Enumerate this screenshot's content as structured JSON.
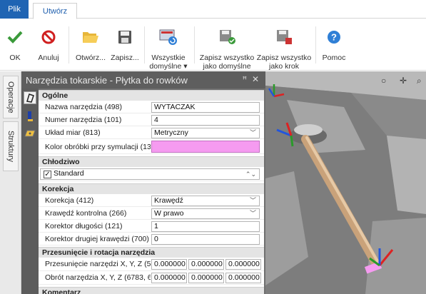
{
  "tabs": {
    "file": "Plik",
    "create": "Utwórz"
  },
  "ribbon": {
    "ok": "OK",
    "cancel": "Anuluj",
    "open": "Otwórz...",
    "save": "Zapisz...",
    "all_defaults_1": "Wszystkie",
    "all_defaults_2": "domyślne ▾",
    "save_all_default_1": "Zapisz wszystko",
    "save_all_default_2": "jako domyślne",
    "save_all_step_1": "Zapisz wszystko",
    "save_all_step_2": "jako krok",
    "help": "Pomoc"
  },
  "side_tabs": {
    "operations": "Operacje",
    "structures": "Struktury"
  },
  "panel": {
    "title": "Narzędzia tokarskie - Płytka do rowków",
    "pin": "ꟸ",
    "close": "✕"
  },
  "sections": {
    "general": "Ogólne",
    "coolant": "Chłodziwo",
    "correction": "Korekcja",
    "shift": "Przesunięcie i rotacja narzędzia",
    "comment": "Komentarz"
  },
  "general": {
    "tool_name_label": "Nazwa narzędzia (498)",
    "tool_name_value": "WYTACZAK",
    "tool_number_label": "Numer narzędzia (101)",
    "tool_number_value": "4",
    "units_label": "Układ miar (813)",
    "units_value": "Metryczny",
    "color_label": "Kolor obróbki przy symulacji (13..."
  },
  "coolant": {
    "standard": "Standard"
  },
  "correction": {
    "corr_label": "Korekcja (412)",
    "corr_value": "Krawędź",
    "edge_label": "Krawędź kontrolna (266)",
    "edge_value": "W prawo",
    "len_label": "Korektor długości (121)",
    "len_value": "1",
    "edge2_label": "Korektor drugiej krawędzi (700)",
    "edge2_value": "0"
  },
  "shift": {
    "move_label": "Przesunięcie narzędzi X, Y, Z (5...",
    "move_x": "0.000000",
    "move_y": "0.000000",
    "move_z": "0.000000",
    "rot_label": "Obrót narzędzia X, Y, Z (6783, 6...",
    "rot_x": "0.000000",
    "rot_y": "0.000000",
    "rot_z": "0.000000"
  },
  "colors": {
    "accent": "#1f64b3",
    "sim_color": "#f59bf0",
    "ok_green": "#3a9a3a",
    "cancel_red": "#d02020"
  }
}
